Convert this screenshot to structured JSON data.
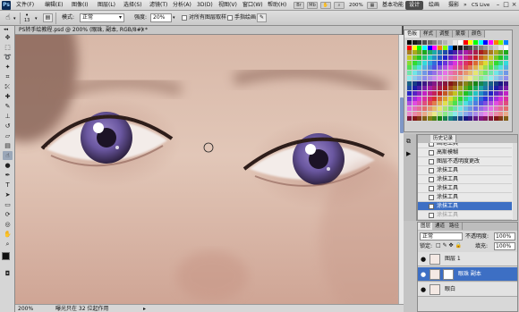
{
  "menubar": {
    "logo": "Ps",
    "items": [
      "文件(F)",
      "编辑(E)",
      "图像(I)",
      "图层(L)",
      "选择(S)",
      "滤镜(T)",
      "分析(A)",
      "3D(D)",
      "视图(V)",
      "窗口(W)",
      "帮助(H)"
    ],
    "zoom": "200%",
    "workspaces": [
      "基本功能",
      "设计",
      "绘画",
      "摄影"
    ],
    "active_workspace": "设计",
    "more": "»",
    "cs_live": "CS Live"
  },
  "options": {
    "brush_size": "13",
    "mode_label": "模式:",
    "mode_value": "正常",
    "strength_label": "强度:",
    "strength_value": "20%",
    "sample_all_label": "对所有图层取样",
    "finger_paint_label": "手指绘画"
  },
  "document": {
    "tab_title": "PS转手绘教程.psd @ 200% (眼珠, 副本, RGB/8#) *",
    "close": "×"
  },
  "status": {
    "zoom": "200%",
    "info": "曝光只在 32 位起作用"
  },
  "swatches_panel": {
    "tabs": [
      "色板",
      "样式",
      "调整",
      "蒙版",
      "颜色"
    ],
    "colors": [
      "#000000",
      "#1a1a1a",
      "#333333",
      "#4d4d4d",
      "#666666",
      "#808080",
      "#999999",
      "#b3b3b3",
      "#cccccc",
      "#e6e6e6",
      "#ffffff",
      "#ff0000",
      "#ffff00",
      "#00ff00",
      "#00ffff",
      "#0000ff",
      "#ff00ff",
      "#ff8000",
      "#80ff00",
      "#0080ff"
    ]
  },
  "history_panel": {
    "tabs": [
      "历史记录"
    ],
    "items": [
      {
        "label": "新建图层"
      },
      {
        "label": "画笔工具"
      },
      {
        "label": "高斯模糊"
      },
      {
        "label": "图层不透明度更改"
      },
      {
        "label": "涂抹工具"
      },
      {
        "label": "涂抹工具"
      },
      {
        "label": "涂抹工具"
      },
      {
        "label": "涂抹工具"
      },
      {
        "label": "涂抹工具"
      },
      {
        "label": "涂抹工具"
      }
    ],
    "selected_index": 8,
    "dimmed_index": 9
  },
  "layers_panel": {
    "tabs": [
      "图层",
      "通道",
      "路径"
    ],
    "blend_mode": "正常",
    "opacity_label": "不透明度:",
    "opacity_value": "100%",
    "lock_label": "锁定:",
    "fill_label": "填充:",
    "fill_value": "100%",
    "layers": [
      {
        "name": "图层 1"
      },
      {
        "name": "眼珠 副本"
      },
      {
        "name": "眼白"
      }
    ],
    "selected_index": 1
  },
  "colors": {
    "accent": "#3d6fc4",
    "workspace_active": "#4c4c4c"
  }
}
